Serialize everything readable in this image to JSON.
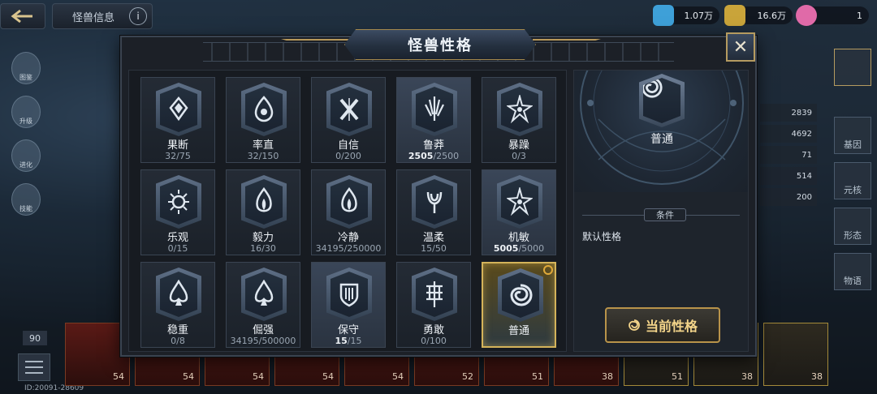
{
  "topbar": {
    "monster_info_label": "怪兽信息",
    "currency": [
      {
        "value": "1.07万",
        "color": "#3ea0d8",
        "icon": "blue-gem-icon"
      },
      {
        "value": "16.6万",
        "color": "#c9a43a",
        "icon": "gold-coin-icon"
      },
      {
        "value": "1",
        "color": "#e06aa8",
        "icon": "pink-swirl-icon"
      }
    ]
  },
  "left_sidebar": [
    "图鉴",
    "升级",
    "进化",
    "技能"
  ],
  "right_stats": [
    "2839",
    "4692",
    "71",
    "514",
    "200"
  ],
  "right_sidebar": [
    "基因",
    "元核",
    "形态",
    "物语"
  ],
  "bottom": {
    "level_badge": "90",
    "id_text": "ID:20091-28609",
    "cards": [
      "54",
      "54",
      "54",
      "54",
      "54",
      "52",
      "51",
      "38",
      "51",
      "38",
      "38"
    ]
  },
  "modal": {
    "title": "怪兽性格",
    "close_label": "✕",
    "traits": [
      {
        "name": "果断",
        "current": "32",
        "max": "75",
        "full": false,
        "dark": false,
        "glyph": "diamond"
      },
      {
        "name": "率直",
        "current": "32",
        "max": "150",
        "full": false,
        "dark": false,
        "glyph": "drop"
      },
      {
        "name": "自信",
        "current": "0",
        "max": "200",
        "full": false,
        "dark": false,
        "glyph": "x"
      },
      {
        "name": "鲁莽",
        "current": "2505",
        "max": "2500",
        "full": true,
        "dark": true,
        "glyph": "claw"
      },
      {
        "name": "暴躁",
        "current": "0",
        "max": "3",
        "full": false,
        "dark": false,
        "glyph": "star"
      },
      {
        "name": "乐观",
        "current": "0",
        "max": "15",
        "full": false,
        "dark": false,
        "glyph": "sun"
      },
      {
        "name": "毅力",
        "current": "16",
        "max": "30",
        "full": false,
        "dark": false,
        "glyph": "flame"
      },
      {
        "name": "冷静",
        "current": "34195",
        "max": "250000",
        "full": false,
        "dark": false,
        "glyph": "flame"
      },
      {
        "name": "温柔",
        "current": "15",
        "max": "50",
        "full": false,
        "dark": false,
        "glyph": "tulip"
      },
      {
        "name": "机敏",
        "current": "5005",
        "max": "5000",
        "full": true,
        "dark": true,
        "glyph": "star"
      },
      {
        "name": "稳重",
        "current": "0",
        "max": "8",
        "full": false,
        "dark": false,
        "glyph": "spade"
      },
      {
        "name": "倔强",
        "current": "34195",
        "max": "500000",
        "full": false,
        "dark": false,
        "glyph": "spade"
      },
      {
        "name": "保守",
        "current": "15",
        "max": "15",
        "full": true,
        "dark": true,
        "glyph": "shield"
      },
      {
        "name": "勇敢",
        "current": "0",
        "max": "100",
        "full": false,
        "dark": false,
        "glyph": "tower"
      },
      {
        "name": "普通",
        "current": "",
        "max": "",
        "full": false,
        "dark": false,
        "glyph": "swirl",
        "selected": true
      }
    ],
    "detail": {
      "name": "普通",
      "condition_label": "条件",
      "condition_text": "默认性格",
      "current_button": "当前性格"
    }
  }
}
